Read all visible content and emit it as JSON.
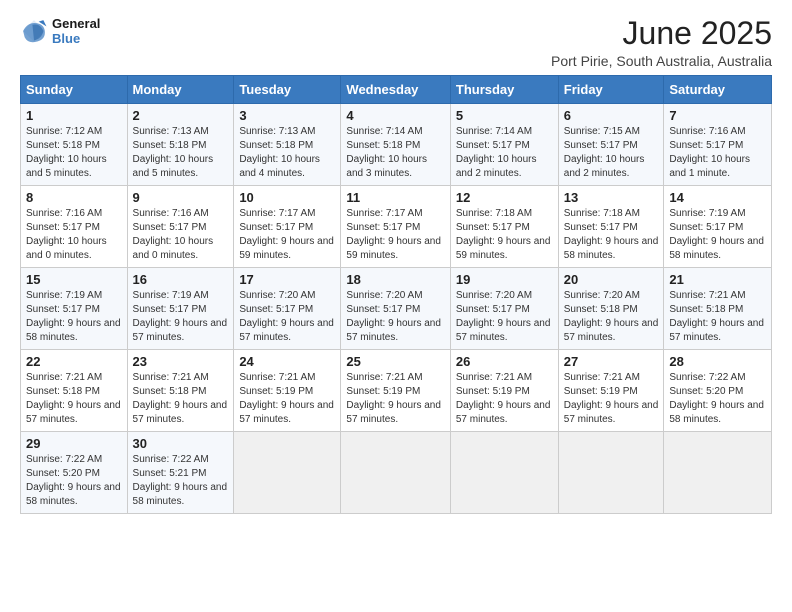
{
  "logo": {
    "line1": "General",
    "line2": "Blue"
  },
  "title": "June 2025",
  "location": "Port Pirie, South Australia, Australia",
  "days_header": [
    "Sunday",
    "Monday",
    "Tuesday",
    "Wednesday",
    "Thursday",
    "Friday",
    "Saturday"
  ],
  "weeks": [
    [
      {
        "num": "1",
        "sunrise": "7:12 AM",
        "sunset": "5:18 PM",
        "daylight": "10 hours and 5 minutes"
      },
      {
        "num": "2",
        "sunrise": "7:13 AM",
        "sunset": "5:18 PM",
        "daylight": "10 hours and 5 minutes"
      },
      {
        "num": "3",
        "sunrise": "7:13 AM",
        "sunset": "5:18 PM",
        "daylight": "10 hours and 4 minutes"
      },
      {
        "num": "4",
        "sunrise": "7:14 AM",
        "sunset": "5:18 PM",
        "daylight": "10 hours and 3 minutes"
      },
      {
        "num": "5",
        "sunrise": "7:14 AM",
        "sunset": "5:17 PM",
        "daylight": "10 hours and 2 minutes"
      },
      {
        "num": "6",
        "sunrise": "7:15 AM",
        "sunset": "5:17 PM",
        "daylight": "10 hours and 2 minutes"
      },
      {
        "num": "7",
        "sunrise": "7:16 AM",
        "sunset": "5:17 PM",
        "daylight": "10 hours and 1 minute"
      }
    ],
    [
      {
        "num": "8",
        "sunrise": "7:16 AM",
        "sunset": "5:17 PM",
        "daylight": "10 hours and 0 minutes"
      },
      {
        "num": "9",
        "sunrise": "7:16 AM",
        "sunset": "5:17 PM",
        "daylight": "10 hours and 0 minutes"
      },
      {
        "num": "10",
        "sunrise": "7:17 AM",
        "sunset": "5:17 PM",
        "daylight": "9 hours and 59 minutes"
      },
      {
        "num": "11",
        "sunrise": "7:17 AM",
        "sunset": "5:17 PM",
        "daylight": "9 hours and 59 minutes"
      },
      {
        "num": "12",
        "sunrise": "7:18 AM",
        "sunset": "5:17 PM",
        "daylight": "9 hours and 59 minutes"
      },
      {
        "num": "13",
        "sunrise": "7:18 AM",
        "sunset": "5:17 PM",
        "daylight": "9 hours and 58 minutes"
      },
      {
        "num": "14",
        "sunrise": "7:19 AM",
        "sunset": "5:17 PM",
        "daylight": "9 hours and 58 minutes"
      }
    ],
    [
      {
        "num": "15",
        "sunrise": "7:19 AM",
        "sunset": "5:17 PM",
        "daylight": "9 hours and 58 minutes"
      },
      {
        "num": "16",
        "sunrise": "7:19 AM",
        "sunset": "5:17 PM",
        "daylight": "9 hours and 57 minutes"
      },
      {
        "num": "17",
        "sunrise": "7:20 AM",
        "sunset": "5:17 PM",
        "daylight": "9 hours and 57 minutes"
      },
      {
        "num": "18",
        "sunrise": "7:20 AM",
        "sunset": "5:17 PM",
        "daylight": "9 hours and 57 minutes"
      },
      {
        "num": "19",
        "sunrise": "7:20 AM",
        "sunset": "5:17 PM",
        "daylight": "9 hours and 57 minutes"
      },
      {
        "num": "20",
        "sunrise": "7:20 AM",
        "sunset": "5:18 PM",
        "daylight": "9 hours and 57 minutes"
      },
      {
        "num": "21",
        "sunrise": "7:21 AM",
        "sunset": "5:18 PM",
        "daylight": "9 hours and 57 minutes"
      }
    ],
    [
      {
        "num": "22",
        "sunrise": "7:21 AM",
        "sunset": "5:18 PM",
        "daylight": "9 hours and 57 minutes"
      },
      {
        "num": "23",
        "sunrise": "7:21 AM",
        "sunset": "5:18 PM",
        "daylight": "9 hours and 57 minutes"
      },
      {
        "num": "24",
        "sunrise": "7:21 AM",
        "sunset": "5:19 PM",
        "daylight": "9 hours and 57 minutes"
      },
      {
        "num": "25",
        "sunrise": "7:21 AM",
        "sunset": "5:19 PM",
        "daylight": "9 hours and 57 minutes"
      },
      {
        "num": "26",
        "sunrise": "7:21 AM",
        "sunset": "5:19 PM",
        "daylight": "9 hours and 57 minutes"
      },
      {
        "num": "27",
        "sunrise": "7:21 AM",
        "sunset": "5:19 PM",
        "daylight": "9 hours and 57 minutes"
      },
      {
        "num": "28",
        "sunrise": "7:22 AM",
        "sunset": "5:20 PM",
        "daylight": "9 hours and 58 minutes"
      }
    ],
    [
      {
        "num": "29",
        "sunrise": "7:22 AM",
        "sunset": "5:20 PM",
        "daylight": "9 hours and 58 minutes"
      },
      {
        "num": "30",
        "sunrise": "7:22 AM",
        "sunset": "5:21 PM",
        "daylight": "9 hours and 58 minutes"
      },
      null,
      null,
      null,
      null,
      null
    ]
  ]
}
